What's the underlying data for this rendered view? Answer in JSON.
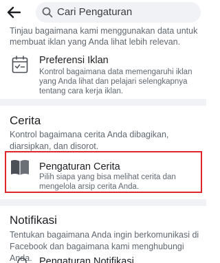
{
  "header": {
    "search_placeholder": "Cari Pengaturan"
  },
  "intro": {
    "text": "Tinjau bagaimana kami menggunakan data untuk membuat iklan yang Anda lihat lebih relevan."
  },
  "ad_preferences": {
    "title": "Preferensi Iklan",
    "description": "Kontrol bagaimana data memengaruhi iklan yang Anda lihat dan pelajari selengkapnya tentang cara kerja iklan."
  },
  "stories": {
    "heading": "Cerita",
    "description": "Kontrol bagaimana cerita Anda dibagikan, diarsipkan, dan disorot.",
    "item_title": "Pengaturan Cerita",
    "item_description": "Pilih siapa yang bisa melihat cerita dan mengelola arsip cerita Anda.",
    "highlight_color": "#e0242c"
  },
  "notifications": {
    "heading": "Notifikasi",
    "description": "Tentukan bagaimana Anda ingin berkomunikasi di Facebook dan bagaimana kami menghubungi Anda.",
    "item_title": "Pengaturan Notifikasi"
  },
  "icons": {
    "back": "back-arrow-icon",
    "search": "search-icon",
    "ad_preferences": "ad-preferences-icon",
    "stories": "book-icon",
    "notifications": "bell-icon"
  }
}
